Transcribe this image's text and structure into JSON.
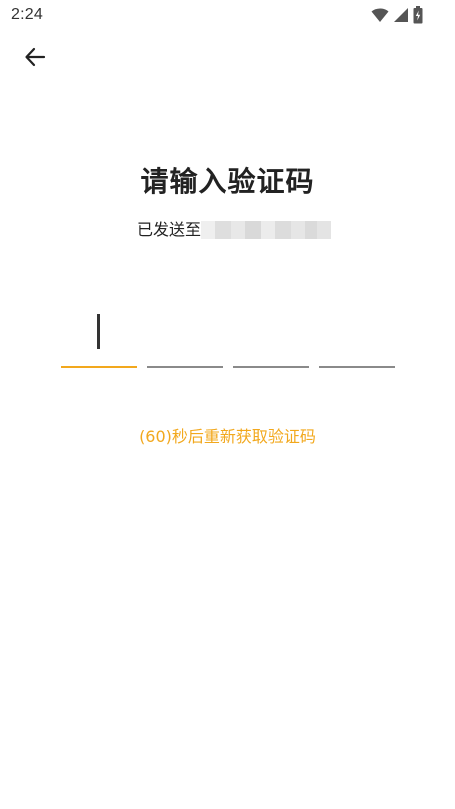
{
  "status_bar": {
    "time": "2:24",
    "icons": [
      "wifi-icon",
      "signal-icon",
      "battery-icon"
    ]
  },
  "header": {
    "back_icon": "arrow-left-icon"
  },
  "main": {
    "title": "请输入验证码",
    "sent_label": "已发送至",
    "code_length": 4,
    "active_index": 0,
    "resend_text": "(60)秒后重新获取验证码"
  },
  "colors": {
    "accent": "#f2a81d",
    "text": "#222222",
    "underline_inactive": "#8a8a8a",
    "background": "#ffffff"
  }
}
